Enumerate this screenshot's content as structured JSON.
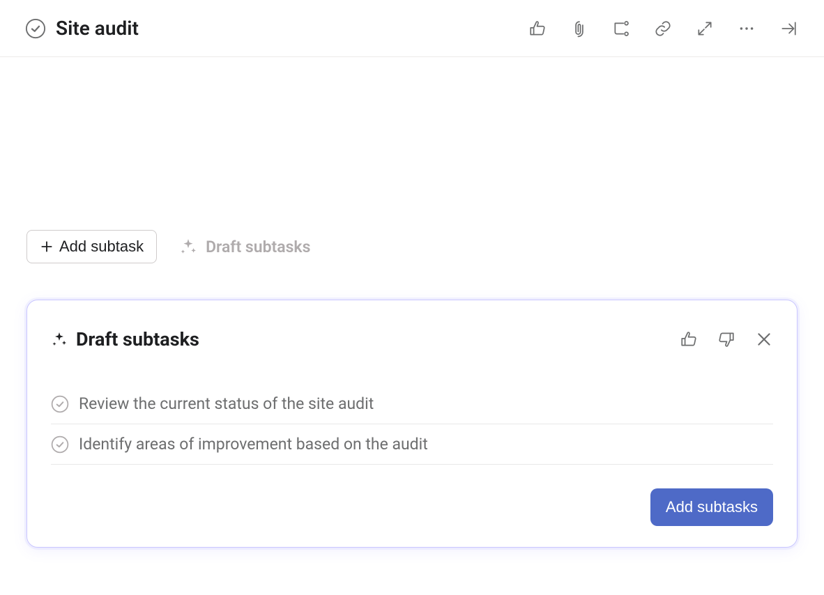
{
  "header": {
    "title": "Site audit"
  },
  "controls": {
    "add_subtask_label": "Add subtask",
    "draft_subtasks_label": "Draft subtasks"
  },
  "panel": {
    "title": "Draft subtasks",
    "subtasks": [
      {
        "text": "Review the current status of the site audit"
      },
      {
        "text": "Identify areas of improvement based on the audit"
      }
    ],
    "add_button_label": "Add subtasks"
  },
  "icons": {
    "check_circle": "check-circle",
    "like": "thumbs-up",
    "dislike": "thumbs-down",
    "attachment": "paperclip",
    "subtask": "subtask",
    "link": "link",
    "expand": "expand",
    "more": "more",
    "close_panel_sidebar": "collapse-right",
    "close": "close",
    "plus": "plus",
    "sparkle": "sparkle"
  },
  "colors": {
    "text": "#1e1f21",
    "muted": "#6d6e6f",
    "light": "#afabac",
    "border": "#edeae9",
    "panel_border": "#c9c6ff",
    "primary": "#4e6ac7"
  }
}
